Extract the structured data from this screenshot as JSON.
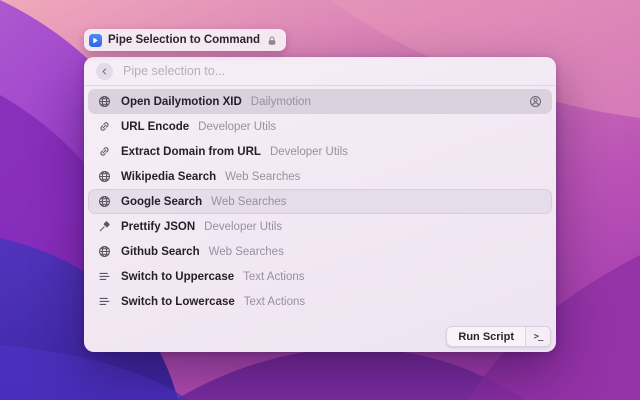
{
  "badge": {
    "app_icon": "app-icon",
    "title": "Pipe Selection to Command",
    "lock_icon": "lock-icon"
  },
  "panel": {
    "search": {
      "back_icon": "chevron-left-icon",
      "placeholder": "Pipe selection to..."
    },
    "list": [
      {
        "title": "Open Dailymotion XID",
        "subtitle": "Dailymotion",
        "icon": "globe-icon",
        "state": "selected",
        "accessory": "person-icon"
      },
      {
        "title": "URL Encode",
        "subtitle": "Developer Utils",
        "icon": "link-icon",
        "state": "",
        "accessory": ""
      },
      {
        "title": "Extract Domain from URL",
        "subtitle": "Developer Utils",
        "icon": "link-icon",
        "state": "",
        "accessory": ""
      },
      {
        "title": "Wikipedia Search",
        "subtitle": "Web Searches",
        "icon": "globe-icon",
        "state": "",
        "accessory": ""
      },
      {
        "title": "Google Search",
        "subtitle": "Web Searches",
        "icon": "globe-icon",
        "state": "hovered",
        "accessory": ""
      },
      {
        "title": "Prettify JSON",
        "subtitle": "Developer Utils",
        "icon": "hammer-icon",
        "state": "",
        "accessory": ""
      },
      {
        "title": "Github Search",
        "subtitle": "Web Searches",
        "icon": "globe-icon",
        "state": "",
        "accessory": ""
      },
      {
        "title": "Switch to Uppercase",
        "subtitle": "Text Actions",
        "icon": "text-lines-icon",
        "state": "",
        "accessory": ""
      },
      {
        "title": "Switch to Lowercase",
        "subtitle": "Text Actions",
        "icon": "text-lines-icon",
        "state": "",
        "accessory": ""
      }
    ],
    "footer": {
      "run_label": "Run Script",
      "shortcut_glyph": ">_"
    }
  },
  "colors": {
    "accent_blue": "#3e7bf6",
    "selected_row": "#dcd1de",
    "hovered_row": "#e7dcea",
    "window_bg": "#f3e9f4"
  }
}
